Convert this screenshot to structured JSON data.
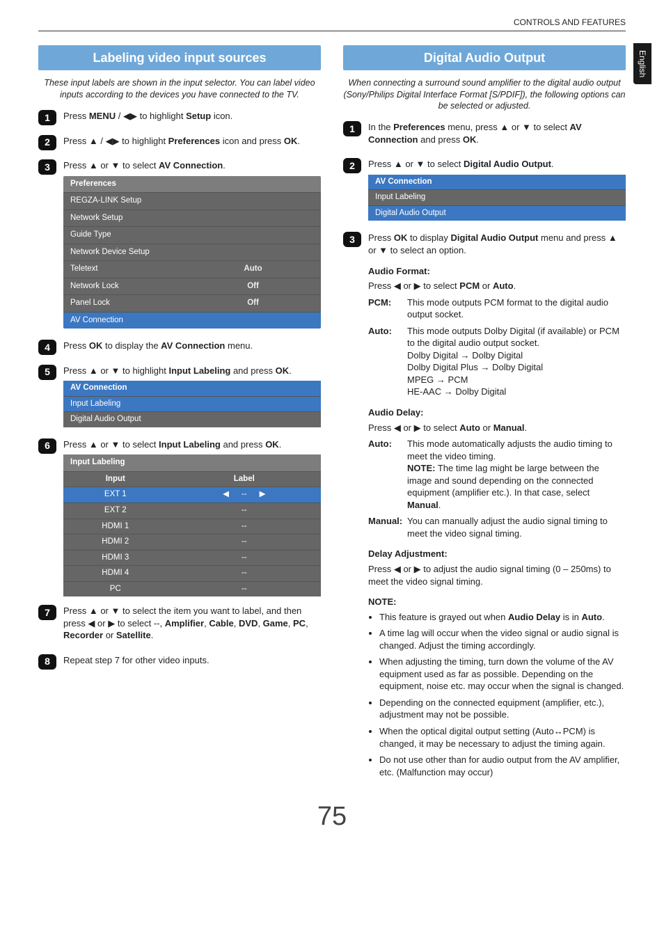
{
  "header": {
    "section": "CONTROLS AND FEATURES",
    "lang_tab": "English"
  },
  "glyphs": {
    "up": "▲",
    "down": "▼",
    "left": "◀",
    "right": "▶",
    "rarrow": "→",
    "lrarrow": "↔",
    "lar": "◀",
    "rar": "▶"
  },
  "left": {
    "title": "Labeling video input sources",
    "intro": "These input labels are shown in the input selector. You can label video inputs according to the devices you have connected to the TV.",
    "steps": {
      "s1_a": "Press ",
      "s1_b": "MENU",
      "s1_c": " / ",
      "s1_d": " to highlight ",
      "s1_e": "Setup",
      "s1_f": " icon.",
      "s2_a": "Press ",
      "s2_b": " / ",
      "s2_c": " to highlight ",
      "s2_d": "Preferences",
      "s2_e": " icon and press ",
      "s2_f": "OK",
      "s2_g": ".",
      "s3_a": "Press ",
      "s3_b": " or ",
      "s3_c": " to select ",
      "s3_d": "AV Connection",
      "s3_e": ".",
      "s4_a": "Press ",
      "s4_b": "OK",
      "s4_c": " to display the ",
      "s4_d": "AV Connection",
      "s4_e": " menu.",
      "s5_a": "Press ",
      "s5_b": " or ",
      "s5_c": " to highlight ",
      "s5_d": "Input Labeling",
      "s5_e": " and press ",
      "s5_f": "OK",
      "s5_g": ".",
      "s6_a": "Press ",
      "s6_b": " or ",
      "s6_c": " to select ",
      "s6_d": "Input Labeling",
      "s6_e": " and press ",
      "s6_f": "OK",
      "s6_g": ".",
      "s7_a": "Press ",
      "s7_b": " or ",
      "s7_c": " to select the item you want to label, and then press ",
      "s7_d": " or ",
      "s7_e": " to select --, ",
      "s7_list_amp": "Amplifier",
      "s7_list_cab": "Cable",
      "s7_list_dvd": "DVD",
      "s7_list_game": "Game",
      "s7_list_pc": "PC",
      "s7_list_rec": "Recorder",
      "s7_list_sat": "Satellite",
      "s7_or": " or ",
      "s7_end": ".",
      "s8": "Repeat step 7 for other video inputs."
    },
    "prefs_menu": {
      "title": "Preferences",
      "rows": [
        {
          "label": "REGZA-LINK Setup",
          "val": ""
        },
        {
          "label": "Network Setup",
          "val": ""
        },
        {
          "label": "Guide Type",
          "val": ""
        },
        {
          "label": "Network Device Setup",
          "val": ""
        },
        {
          "label": "Teletext",
          "val": "Auto"
        },
        {
          "label": "Network Lock",
          "val": "Off"
        },
        {
          "label": "Panel Lock",
          "val": "Off"
        },
        {
          "label": "AV Connection",
          "val": "",
          "sel": true
        }
      ]
    },
    "avconn_menu": {
      "title": "AV Connection",
      "rows": [
        {
          "label": "Input Labeling",
          "sel": true
        },
        {
          "label": "Digital Audio Output"
        }
      ]
    },
    "label_table": {
      "title": "Input Labeling",
      "head_input": "Input",
      "head_label": "Label",
      "rows": [
        {
          "input": "EXT 1",
          "label": "--",
          "sel": true
        },
        {
          "input": "EXT 2",
          "label": "--"
        },
        {
          "input": "HDMI 1",
          "label": "--"
        },
        {
          "input": "HDMI 2",
          "label": "--"
        },
        {
          "input": "HDMI 3",
          "label": "--"
        },
        {
          "input": "HDMI 4",
          "label": "--"
        },
        {
          "input": "PC",
          "label": "--"
        }
      ]
    }
  },
  "right": {
    "title": "Digital Audio Output",
    "intro": "When connecting a surround sound amplifier to the digital audio output (Sony/Philips Digital Interface Format [S/PDIF]), the following options can be selected or adjusted.",
    "steps": {
      "s1_a": "In the ",
      "s1_b": "Preferences",
      "s1_c": " menu, press ",
      "s1_d": " or ",
      "s1_e": " to select ",
      "s1_f": "AV Connection",
      "s1_g": " and press ",
      "s1_h": "OK",
      "s1_i": ".",
      "s2_a": "Press ",
      "s2_b": " or ",
      "s2_c": " to select ",
      "s2_d": "Digital Audio Output",
      "s2_e": ".",
      "s3_a": "Press ",
      "s3_b": "OK",
      "s3_c": " to display ",
      "s3_d": "Digital Audio Output",
      "s3_e": " menu and press ",
      "s3_f": " or ",
      "s3_g": " to select an option."
    },
    "avconn_menu": {
      "title": "AV Connection",
      "rows": [
        {
          "label": "Input Labeling"
        },
        {
          "label": "Digital Audio Output",
          "sel": true
        }
      ]
    },
    "audio_format": {
      "heading": "Audio Format:",
      "line_a": "Press ",
      "line_b": " or ",
      "line_c": " to select ",
      "line_pcm": "PCM",
      "line_or": " or ",
      "line_auto": "Auto",
      "line_end": ".",
      "pcm_term": "PCM:",
      "pcm_desc": "This mode outputs PCM format to the digital audio output socket.",
      "auto_term": "Auto:",
      "auto_d1": "This mode outputs Dolby Digital (if available) or PCM to the digital audio output socket.",
      "auto_d2": "Dolby Digital ",
      "auto_d2b": " Dolby Digital",
      "auto_d3": "Dolby Digital Plus ",
      "auto_d3b": " Dolby Digital",
      "auto_d4": "MPEG ",
      "auto_d4b": " PCM",
      "auto_d5": "HE-AAC ",
      "auto_d5b": " Dolby Digital"
    },
    "audio_delay": {
      "heading": "Audio Delay:",
      "line_a": "Press ",
      "line_b": " or ",
      "line_c": " to select ",
      "line_auto": "Auto",
      "line_or": " or ",
      "line_man": "Manual",
      "line_end": ".",
      "auto_term": "Auto:",
      "auto_desc": "This mode automatically adjusts the audio timing to meet the video timing.",
      "auto_note_label": "NOTE:",
      "auto_note": " The time lag might be large between the image and sound depending on the connected equipment (amplifier etc.). In that case, select ",
      "auto_note_man": "Manual",
      "auto_note_end": ".",
      "man_term": "Manual:",
      "man_desc": "You can manually adjust the audio signal timing to meet the video signal timing."
    },
    "delay_adj": {
      "heading": "Delay Adjustment:",
      "line_a": "Press ",
      "line_b": " or ",
      "line_c": " to adjust the audio signal timing (0 – 250ms) to meet the video signal timing."
    },
    "note": {
      "heading": "NOTE:",
      "n1_a": "This feature is grayed out when ",
      "n1_b": "Audio Delay",
      "n1_c": " is in ",
      "n1_d": "Auto",
      "n1_e": ".",
      "n2": "A time lag will occur when the video signal or audio signal is changed. Adjust the timing accordingly.",
      "n3": "When adjusting the timing, turn down the volume of the AV equipment used as far as possible. Depending on the equipment, noise etc. may occur when the signal is changed.",
      "n4": "Depending on the connected equipment (amplifier, etc.), adjustment may not be possible.",
      "n5_a": "When the optical digital output setting (Auto",
      "n5_b": "PCM) is changed, it may be necessary to adjust the timing again.",
      "n6": "Do not use other than for audio output from the AV amplifier, etc. (Malfunction may occur)"
    }
  },
  "page_number": "75"
}
